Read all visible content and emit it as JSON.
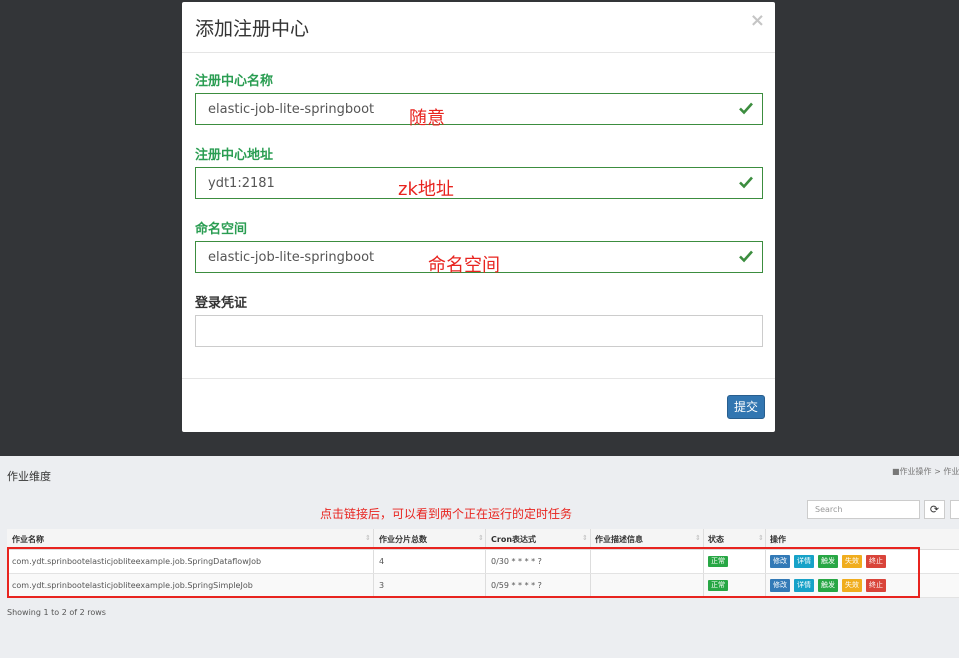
{
  "modal": {
    "title": "添加注册中心",
    "close_label": "×",
    "fields": [
      {
        "label": "注册中心名称",
        "value": "elastic-job-lite-springboot",
        "valid": true,
        "annotation": "随意"
      },
      {
        "label": "注册中心地址",
        "value": "ydt1:2181",
        "valid": true,
        "annotation": "zk地址"
      },
      {
        "label": "命名空间",
        "value": "elastic-job-lite-springboot",
        "valid": true,
        "annotation": "命名空间"
      },
      {
        "label": "登录凭证",
        "value": "",
        "valid": false,
        "annotation": ""
      }
    ],
    "submit_label": "提交"
  },
  "jobs_page": {
    "title": "作业维度",
    "breadcrumb": "■作业操作 > 作业",
    "note": "点击链接后，可以看到两个正在运行的定时任务",
    "search_placeholder": "Search",
    "columns": [
      "作业名称",
      "作业分片总数",
      "Cron表达式",
      "作业描述信息",
      "状态",
      "操作"
    ],
    "rows": [
      {
        "name": "com.ydt.sprinbootelasticjobliteexample.job.SpringDataflowJob",
        "shards": "4",
        "cron": "0/30 * * * * ?",
        "desc": "",
        "status": "正常"
      },
      {
        "name": "com.ydt.sprinbootelasticjobliteexample.job.SpringSimpleJob",
        "shards": "3",
        "cron": "0/59 * * * * ?",
        "desc": "",
        "status": "正常"
      }
    ],
    "actions": [
      {
        "label": "修改",
        "color": "#337ab7"
      },
      {
        "label": "详情",
        "color": "#17a2c8"
      },
      {
        "label": "触发",
        "color": "#28a745"
      },
      {
        "label": "失效",
        "color": "#f0ad1e"
      },
      {
        "label": "终止",
        "color": "#d9443a"
      }
    ],
    "footer": "Showing 1 to 2 of 2 rows"
  },
  "colors": {
    "valid": "#3c8d3f",
    "annotation": "#e8241f",
    "backdrop": "#333538"
  }
}
